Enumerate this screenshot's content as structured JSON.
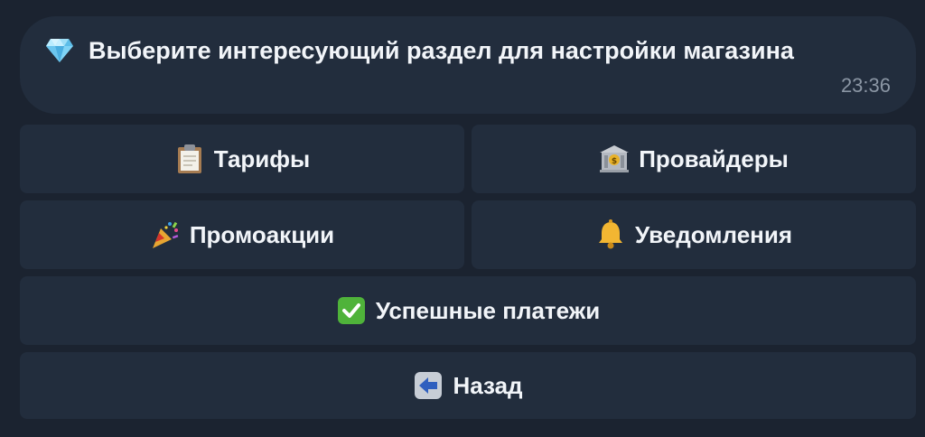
{
  "message": {
    "icon": "gem-icon",
    "text": "Выберите интересующий раздел для настройки магазина",
    "time": "23:36"
  },
  "keyboard": {
    "buttons": [
      {
        "label": "Тарифы",
        "icon": "clipboard-icon"
      },
      {
        "label": "Провайдеры",
        "icon": "bank-icon"
      },
      {
        "label": "Промоакции",
        "icon": "party-popper-icon"
      },
      {
        "label": "Уведомления",
        "icon": "bell-icon"
      },
      {
        "label": "Успешные платежи",
        "icon": "check-mark-icon"
      },
      {
        "label": "Назад",
        "icon": "left-arrow-icon"
      }
    ]
  },
  "colors": {
    "background": "#1b2330",
    "bubble": "#222d3d",
    "text": "#f2f5f9",
    "time": "#8b96a4"
  }
}
